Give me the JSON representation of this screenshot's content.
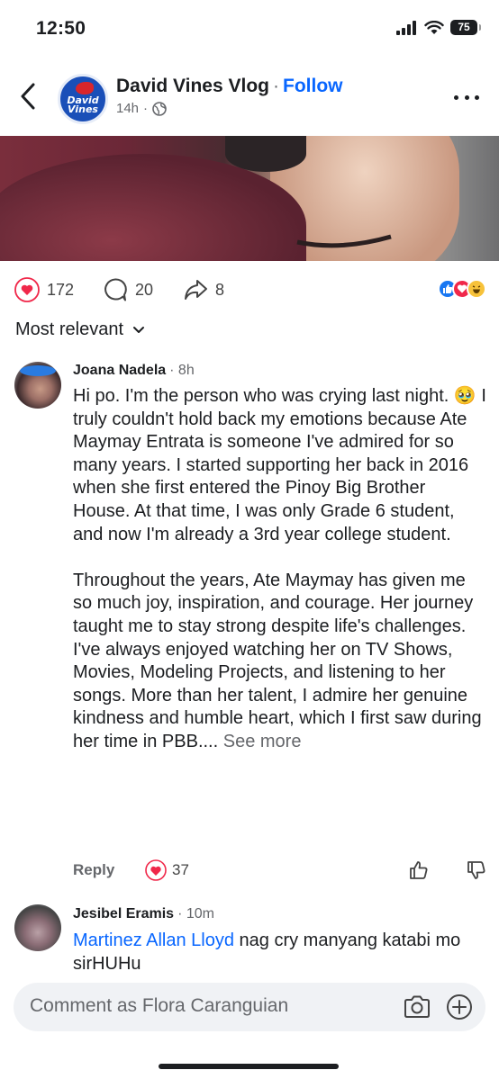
{
  "status_bar": {
    "time": "12:50",
    "battery": "75"
  },
  "header": {
    "page_name": "David Vines Vlog",
    "separator": "·",
    "follow_label": "Follow",
    "time_ago": "14h",
    "meta_dot": "·",
    "avatar_text_line1": "David",
    "avatar_text_line2": "Vines"
  },
  "stats": {
    "likes": "172",
    "comments": "20",
    "shares": "8"
  },
  "sort": {
    "label": "Most relevant"
  },
  "comments": [
    {
      "author": "Joana Nadela",
      "time_ago": "· 8h",
      "text": "Hi po. I'm the person who was crying last night. 🥹 I truly couldn't hold back my emotions because Ate Maymay Entrata is someone I've admired for so many years. I started supporting her back in 2016 when she first entered the Pinoy Big Brother House. At that time, I was only Grade 6 student, and now I'm already a 3rd year college student.\n\nThroughout the years, Ate Maymay has given me so much joy, inspiration, and courage. Her journey taught me to stay strong despite life's challenges. I've always enjoyed watching her on TV Shows, Movies, Modeling Projects, and listening to her songs. More than her talent, I admire her genuine kindness and humble heart, which I first saw during her time in PBB.... ",
      "see_more": "See more",
      "reply_label": "Reply",
      "reaction_count": "37"
    },
    {
      "author": "Jesibel Eramis",
      "time_ago": "· 10m",
      "mention": "Martinez Allan Lloyd",
      "text": " nag cry manyang katabi mo sirHUHu"
    }
  ],
  "composer": {
    "placeholder": "Comment as Flora Caranguian"
  },
  "colors": {
    "accent": "#0866ff",
    "like_red": "#f0284a",
    "text": "#1c1e21",
    "muted": "#65676b"
  }
}
